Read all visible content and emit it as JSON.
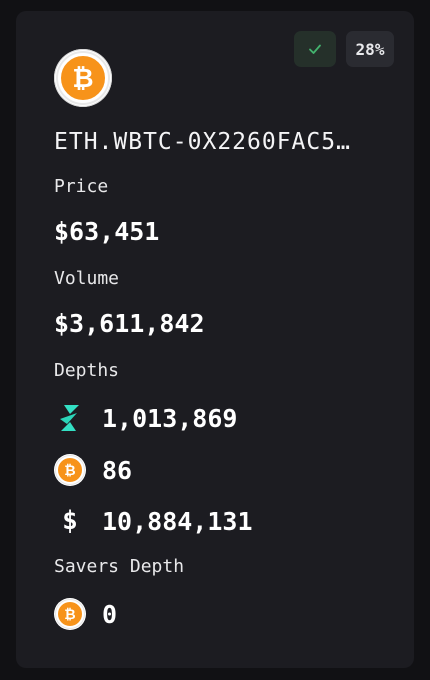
{
  "status": {
    "check_icon": "check-icon",
    "percent": "28%"
  },
  "asset": {
    "icon": "bitcoin-icon",
    "pair": "ETH.WBTC-0X2260FAC5…"
  },
  "price": {
    "label": "Price",
    "value": "$63,451"
  },
  "volume": {
    "label": "Volume",
    "value": "$3,611,842"
  },
  "depths": {
    "label": "Depths",
    "items": [
      {
        "icon": "thorchain-rune-icon",
        "value": "1,013,869"
      },
      {
        "icon": "bitcoin-icon",
        "value": "86"
      },
      {
        "icon": "dollar-icon",
        "value": "10,884,131"
      }
    ]
  },
  "savers": {
    "label": "Savers Depth",
    "icon": "bitcoin-icon",
    "value": "0"
  },
  "colors": {
    "background": "#111114",
    "card": "#1c1c21",
    "bitcoin": "#f7931a",
    "rune": "#33e0c4",
    "check": "#43b36e"
  }
}
